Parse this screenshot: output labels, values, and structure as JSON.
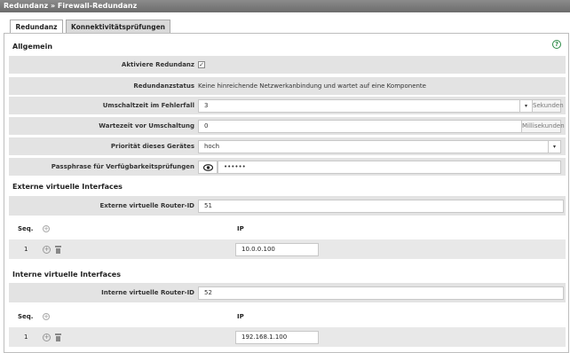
{
  "title": "Redundanz » Firewall-Redundanz",
  "tabs": [
    {
      "label": "Redundanz",
      "active": true
    },
    {
      "label": "Konnektivitätsprüfungen",
      "active": false
    }
  ],
  "general": {
    "heading": "Allgemein",
    "help_icon": "?",
    "activate": {
      "label": "Aktiviere Redundanz",
      "checked": true,
      "mark": "✓"
    },
    "status": {
      "label": "Redundanzstatus",
      "value": "Keine hinreichende Netzwerkanbindung und wartet auf eine Komponente"
    },
    "failover": {
      "label": "Umschaltzeit im Fehlerfall",
      "value": "3",
      "unit": "Sekunden"
    },
    "wait": {
      "label": "Wartezeit vor Umschaltung",
      "value": "0",
      "unit": "Millisekunden"
    },
    "priority": {
      "label": "Priorität dieses Gerätes",
      "value": "hoch"
    },
    "passphrase": {
      "label": "Passphrase für Verfügbarkeitsprüfungen",
      "value": "••••••"
    },
    "dropdown_glyph": "▾"
  },
  "external": {
    "heading": "Externe virtuelle Interfaces",
    "router_id": {
      "label": "Externe virtuelle Router-ID",
      "value": "51"
    },
    "col_seq": "Seq.",
    "col_ip": "IP",
    "add_glyph": "+",
    "rows": [
      {
        "seq": "1",
        "ip": "10.0.0.100"
      }
    ]
  },
  "internal": {
    "heading": "Interne virtuelle Interfaces",
    "router_id": {
      "label": "Interne virtuelle Router-ID",
      "value": "52"
    },
    "col_seq": "Seq.",
    "col_ip": "IP",
    "add_glyph": "+",
    "rows": [
      {
        "seq": "1",
        "ip": "192.168.1.100"
      }
    ]
  },
  "colors": {
    "accent": "#2a8a44",
    "row_bg": "#e3e3e3",
    "titlebar": "#7a7a7a"
  }
}
